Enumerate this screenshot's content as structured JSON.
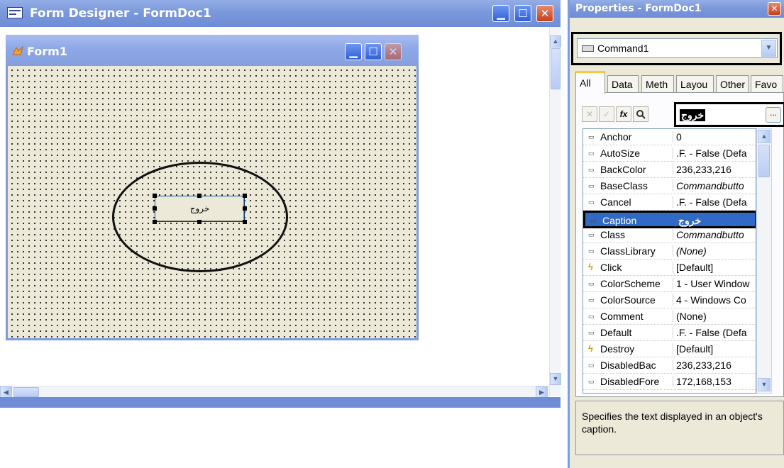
{
  "form_designer": {
    "title": "Form Designer - FormDoc1"
  },
  "form1": {
    "title": "Form1",
    "command_button_caption": "خروج"
  },
  "properties": {
    "title": "Properties - FormDoc1",
    "object_selector": "Command1",
    "tabs": [
      "All",
      "Data",
      "Meth",
      "Layou",
      "Other",
      "Favo"
    ],
    "value_edit": "خروج",
    "value_edit_button": "...",
    "rows": [
      {
        "name": "Anchor",
        "value": "0",
        "icon": "property-icon"
      },
      {
        "name": "AutoSize",
        "value": ".F. - False (Defa",
        "icon": "property-icon"
      },
      {
        "name": "BackColor",
        "value": "236,233,216",
        "icon": "property-icon"
      },
      {
        "name": "BaseClass",
        "value": "Commandbutto",
        "icon": "property-icon",
        "italic": true
      },
      {
        "name": "Cancel",
        "value": ".F. - False (Defa",
        "icon": "property-icon"
      },
      {
        "name": "Caption",
        "value": "خروج",
        "icon": "property-icon",
        "selected": true
      },
      {
        "name": "Class",
        "value": "Commandbutto",
        "icon": "property-icon",
        "italic": true
      },
      {
        "name": "ClassLibrary",
        "value": "(None)",
        "icon": "property-icon",
        "italic": true
      },
      {
        "name": "Click",
        "value": "[Default]",
        "icon": "event-icon"
      },
      {
        "name": "ColorScheme",
        "value": "1 - User Window",
        "icon": "property-icon"
      },
      {
        "name": "ColorSource",
        "value": "4 - Windows Co",
        "icon": "property-icon"
      },
      {
        "name": "Comment",
        "value": "(None)",
        "icon": "property-icon"
      },
      {
        "name": "Default",
        "value": ".F. - False (Defa",
        "icon": "property-icon"
      },
      {
        "name": "Destroy",
        "value": "[Default]",
        "icon": "event-icon"
      },
      {
        "name": "DisabledBac",
        "value": "236,233,216",
        "icon": "property-icon"
      },
      {
        "name": "DisabledFore",
        "value": "172,168,153",
        "icon": "property-icon"
      }
    ],
    "description": "Specifies the text displayed in an object's caption."
  }
}
